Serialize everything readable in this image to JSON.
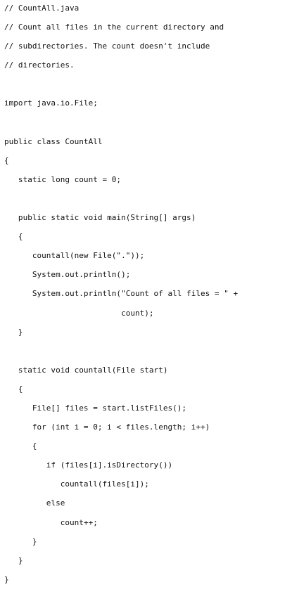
{
  "code": {
    "language": "java",
    "file_name": "CountAll.java",
    "lines": [
      "// CountAll.java",
      "// Count all files in the current directory and",
      "// subdirectories. The count doesn't include",
      "// directories.",
      "",
      "import java.io.File;",
      "",
      "public class CountAll",
      "{",
      "   static long count = 0;",
      "",
      "   public static void main(String[] args)",
      "   {",
      "      countall(new File(\".\"));",
      "      System.out.println();",
      "      System.out.println(\"Count of all files = \" +",
      "                         count);",
      "   }",
      "",
      "   static void countall(File start)",
      "   {",
      "      File[] files = start.listFiles();",
      "      for (int i = 0; i < files.length; i++)",
      "      {",
      "         if (files[i].isDirectory())",
      "            countall(files[i]);",
      "         else",
      "            count++;",
      "      }",
      "   }",
      "}"
    ]
  }
}
